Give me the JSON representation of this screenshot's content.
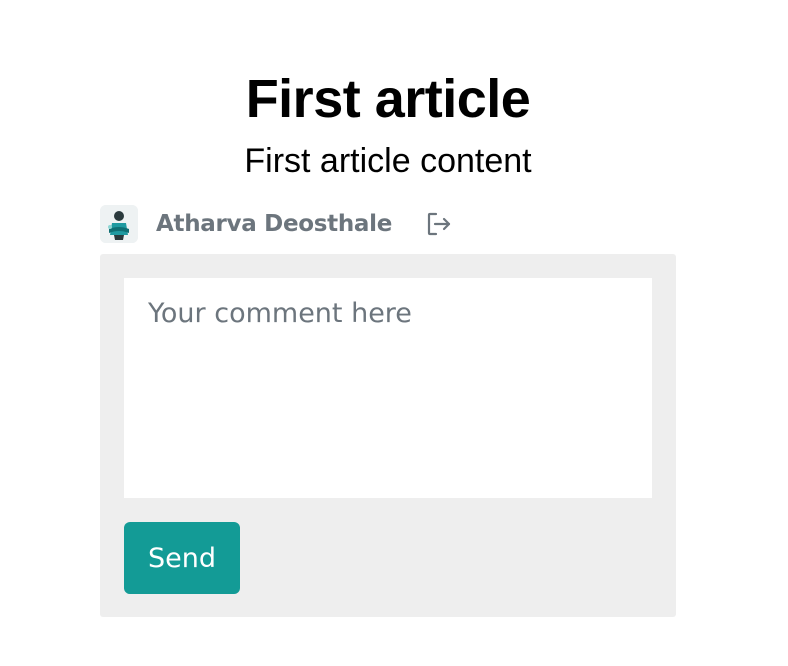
{
  "article": {
    "title": "First article",
    "content": "First article content"
  },
  "user": {
    "name": "Atharva Deosthale",
    "avatar_icon": "user-avatar",
    "logout_icon": "logout-icon"
  },
  "comment_form": {
    "placeholder": "Your comment here",
    "value": "",
    "send_label": "Send"
  },
  "colors": {
    "accent": "#139b96",
    "panel_bg": "#eeeeee",
    "muted_text": "#6c757d"
  }
}
